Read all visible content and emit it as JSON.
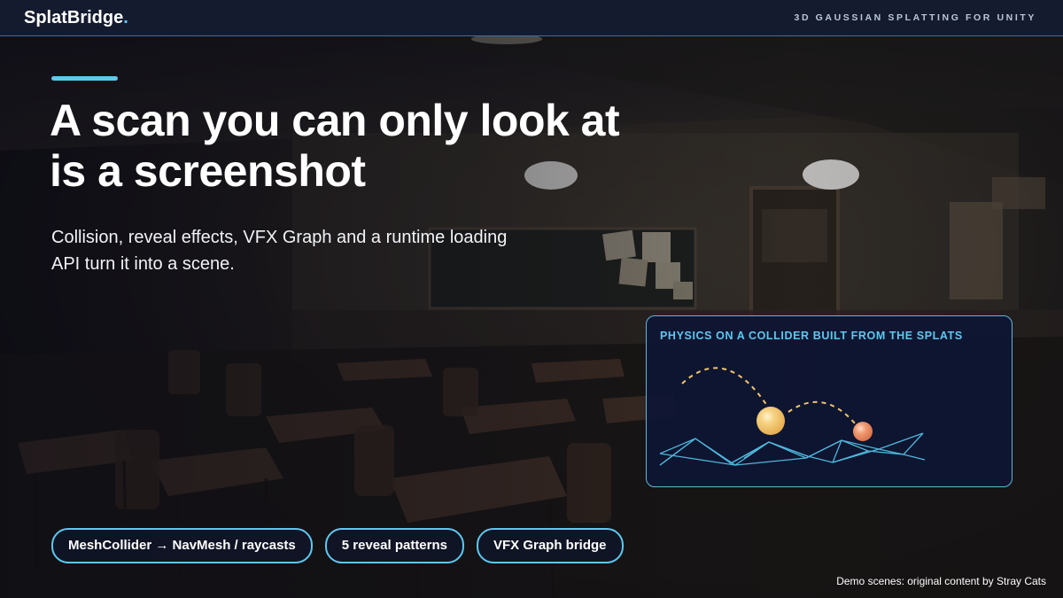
{
  "brand": {
    "name": "SplatBridge",
    "dot": ".",
    "tagline": "3D GAUSSIAN SPLATTING FOR UNITY"
  },
  "headline": {
    "line1": "A scan you can only look at",
    "line2": "is a screenshot"
  },
  "subtitle": {
    "line1": "Collision, reveal effects, VFX Graph and a runtime loading",
    "line2": "API turn it into a scene."
  },
  "physics_card": {
    "title": "PHYSICS ON A COLLIDER BUILT FROM THE SPLATS"
  },
  "pills": [
    {
      "label": "MeshCollider → NavMesh / raycasts"
    },
    {
      "label": "5 reveal patterns"
    },
    {
      "label": "VFX Graph bridge"
    }
  ],
  "credit": "Demo scenes: original content by Stray Cats",
  "colors": {
    "accent": "#5ec8ee",
    "topbar_bg": "#151b2e",
    "card_bg": "#0e1634",
    "ball_large": "#f3c66d",
    "ball_small": "#ec8c62",
    "mesh_line": "#4fb6da"
  },
  "icons": {
    "arrow": "right-arrow"
  }
}
